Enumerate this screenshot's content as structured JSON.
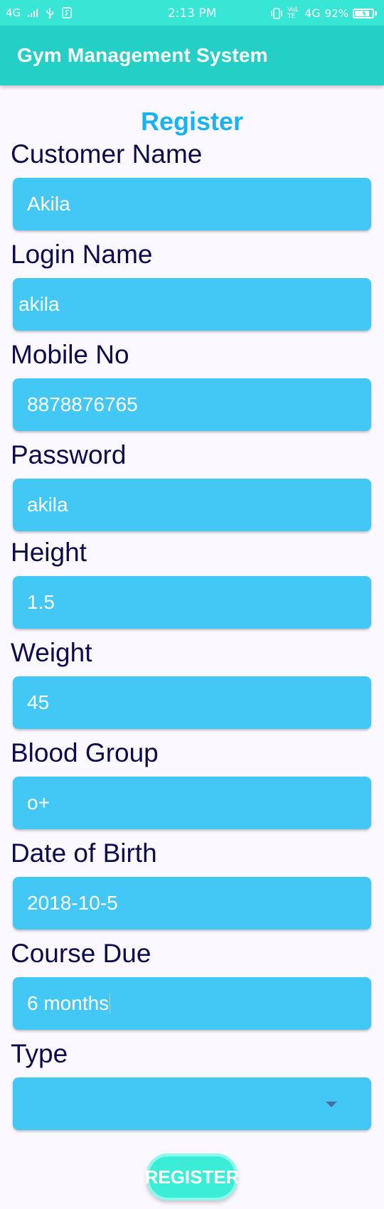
{
  "status_bar": {
    "network": "4G",
    "time": "2:13 PM",
    "volte": "VoLTE",
    "network_right": "4G",
    "battery": "92%",
    "battery_level": 0.92
  },
  "app_bar": {
    "title": "Gym Management System"
  },
  "form": {
    "heading": "Register",
    "fields": [
      {
        "label": "Customer Name",
        "value": "Akila"
      },
      {
        "label": "Login Name",
        "value": "akila"
      },
      {
        "label": "Mobile No",
        "value": "8878876765"
      },
      {
        "label": "Password",
        "value": "akila"
      },
      {
        "label": "Height",
        "value": "1.5"
      },
      {
        "label": "Weight",
        "value": "45"
      },
      {
        "label": "Blood Group",
        "value": "o+"
      },
      {
        "label": "Date of Birth",
        "value": "2018-10-5"
      },
      {
        "label": "Course Due",
        "value": "6 months"
      },
      {
        "label": "Type",
        "value": ""
      }
    ],
    "register_label": "REGISTER"
  },
  "icons": {
    "usb": "usb-icon",
    "sim": "sim-icon",
    "vibrate": "vibrate-icon",
    "battery": "battery-icon",
    "dropdown": "chevron-down-icon"
  },
  "colors": {
    "status_bar": "#37e6d4",
    "app_bar": "#24cfc6",
    "heading": "#1bb3ef",
    "label": "#0c0c4c",
    "field": "#43c8f6",
    "button": "#3bedd7"
  }
}
